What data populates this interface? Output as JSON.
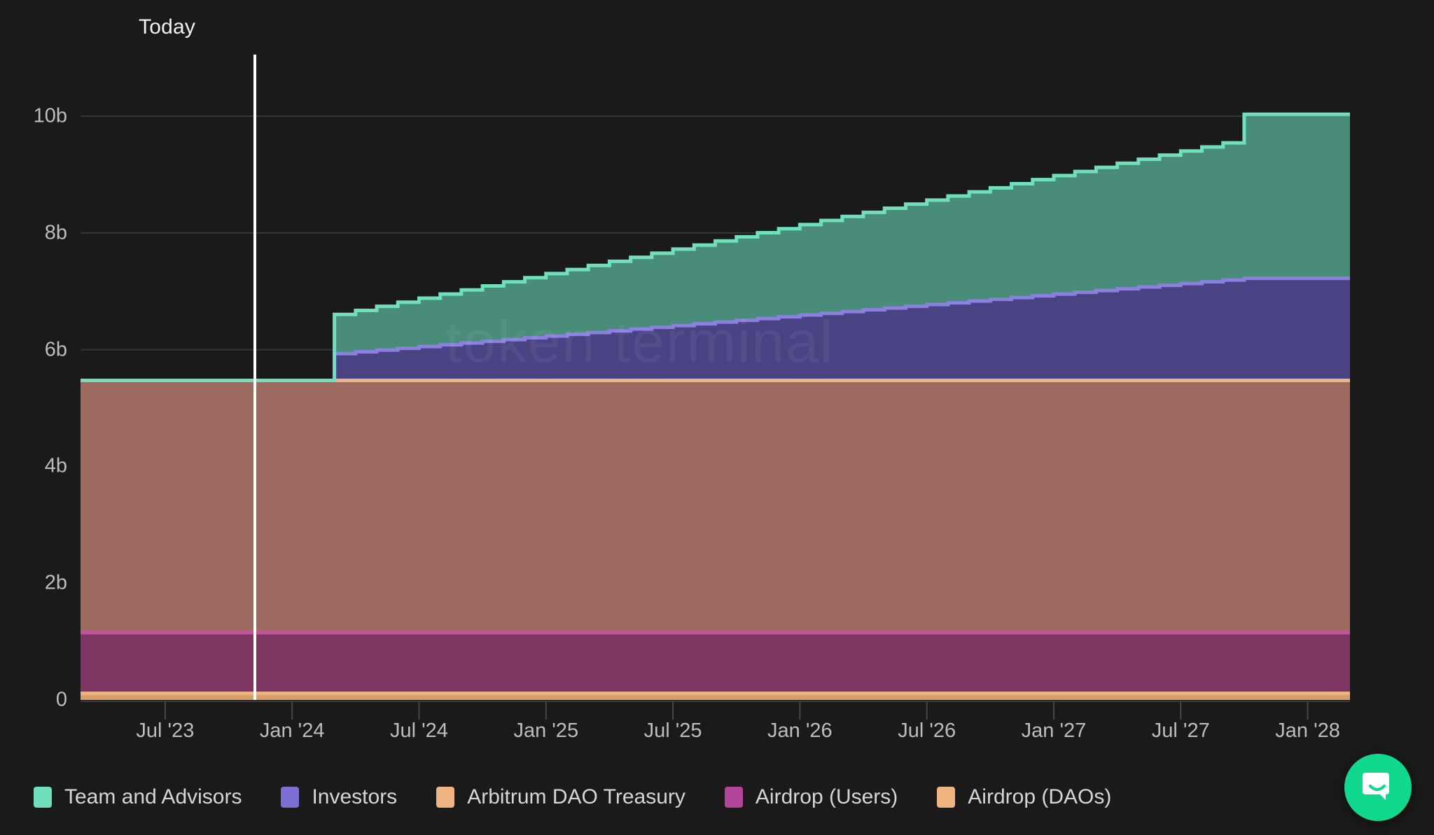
{
  "annotation": {
    "today_label": "Today",
    "today_x_fraction": 0.0958
  },
  "watermark": "token terminal",
  "legend": {
    "items": [
      {
        "label": "Team and Advisors",
        "color": "#6FDFBD"
      },
      {
        "label": "Investors",
        "color": "#7B6FD4"
      },
      {
        "label": "Arbitrum DAO Treasury",
        "color": "#F0B483"
      },
      {
        "label": "Airdrop (Users)",
        "color": "#B3469B"
      },
      {
        "label": "Airdrop (DAOs)",
        "color": "#F0B483"
      }
    ]
  },
  "widgets": {
    "intercom_label": "Open Intercom Messenger",
    "intercom_color": "#10d98e"
  },
  "chart_data": {
    "type": "area",
    "title": "",
    "subtitle": "",
    "xlabel": "",
    "ylabel": "",
    "stacked": true,
    "step": "monthly",
    "grid": true,
    "legend_position": "bottom",
    "ylim": [
      0,
      10400000000
    ],
    "ytick_labels": [
      "0",
      "2b",
      "4b",
      "6b",
      "8b",
      "10b"
    ],
    "ytick_values": [
      0,
      2000000000,
      4000000000,
      6000000000,
      8000000000,
      10000000000
    ],
    "xtick_labels": [
      "Jul '23",
      "Jan '24",
      "Jul '24",
      "Jan '25",
      "Jul '25",
      "Jan '26",
      "Jul '26",
      "Jan '27",
      "Jul '27",
      "Jan '28"
    ],
    "x_start": "2023-03",
    "x_end": "2028-03",
    "series": [
      {
        "name": "Airdrop (DAOs)",
        "color": "#D9A06B",
        "line_color": "#F0B483",
        "values_b": [
          0.113,
          0.113,
          0.113,
          0.113,
          0.113,
          0.113,
          0.113,
          0.113,
          0.113,
          0.113,
          0.113,
          0.113,
          0.113,
          0.113,
          0.113,
          0.113,
          0.113,
          0.113,
          0.113,
          0.113,
          0.113,
          0.113,
          0.113,
          0.113,
          0.113,
          0.113,
          0.113,
          0.113,
          0.113,
          0.113,
          0.113,
          0.113,
          0.113,
          0.113,
          0.113,
          0.113,
          0.113,
          0.113,
          0.113,
          0.113,
          0.113,
          0.113,
          0.113,
          0.113,
          0.113,
          0.113,
          0.113,
          0.113,
          0.113,
          0.113,
          0.113,
          0.113,
          0.113,
          0.113,
          0.113,
          0.113,
          0.113,
          0.113,
          0.113,
          0.113,
          0.113
        ]
      },
      {
        "name": "Airdrop (Users)",
        "color": "#7E3663",
        "line_color": "#C450A5",
        "values_b": [
          1.04,
          1.04,
          1.04,
          1.04,
          1.04,
          1.04,
          1.04,
          1.04,
          1.04,
          1.04,
          1.04,
          1.04,
          1.04,
          1.04,
          1.04,
          1.04,
          1.04,
          1.04,
          1.04,
          1.04,
          1.04,
          1.04,
          1.04,
          1.04,
          1.04,
          1.04,
          1.04,
          1.04,
          1.04,
          1.04,
          1.04,
          1.04,
          1.04,
          1.04,
          1.04,
          1.04,
          1.04,
          1.04,
          1.04,
          1.04,
          1.04,
          1.04,
          1.04,
          1.04,
          1.04,
          1.04,
          1.04,
          1.04,
          1.04,
          1.04,
          1.04,
          1.04,
          1.04,
          1.04,
          1.04,
          1.04,
          1.04,
          1.04,
          1.04,
          1.04,
          1.04
        ]
      },
      {
        "name": "Arbitrum DAO Treasury",
        "color": "#9C6A5E",
        "line_color": "#F0B483",
        "values_b": [
          4.32,
          4.32,
          4.32,
          4.32,
          4.32,
          4.32,
          4.32,
          4.32,
          4.32,
          4.32,
          4.32,
          4.32,
          4.32,
          4.32,
          4.32,
          4.32,
          4.32,
          4.32,
          4.32,
          4.32,
          4.32,
          4.32,
          4.32,
          4.32,
          4.32,
          4.32,
          4.32,
          4.32,
          4.32,
          4.32,
          4.32,
          4.32,
          4.32,
          4.32,
          4.32,
          4.32,
          4.32,
          4.32,
          4.32,
          4.32,
          4.32,
          4.32,
          4.32,
          4.32,
          4.32,
          4.32,
          4.32,
          4.32,
          4.32,
          4.32,
          4.32,
          4.32,
          4.32,
          4.32,
          4.32,
          4.32,
          4.32,
          4.32,
          4.32,
          4.32,
          4.32
        ]
      },
      {
        "name": "Investors",
        "color": "#4A4383",
        "line_color": "#8B7FE0",
        "values_b": [
          0,
          0,
          0,
          0,
          0,
          0,
          0,
          0,
          0,
          0,
          0,
          0,
          0.46,
          0.49,
          0.52,
          0.55,
          0.58,
          0.61,
          0.64,
          0.67,
          0.7,
          0.73,
          0.76,
          0.79,
          0.82,
          0.85,
          0.88,
          0.91,
          0.94,
          0.97,
          1.0,
          1.03,
          1.06,
          1.09,
          1.12,
          1.15,
          1.18,
          1.21,
          1.24,
          1.27,
          1.3,
          1.33,
          1.36,
          1.39,
          1.42,
          1.45,
          1.48,
          1.51,
          1.54,
          1.57,
          1.6,
          1.63,
          1.66,
          1.69,
          1.72,
          1.75,
          1.75,
          1.75,
          1.75,
          1.75,
          1.75
        ]
      },
      {
        "name": "Team and Advisors",
        "color": "#4A8C7A",
        "line_color": "#6FDFBD",
        "values_b": [
          0,
          0,
          0,
          0,
          0,
          0,
          0,
          0,
          0,
          0,
          0,
          0,
          0.67,
          0.71,
          0.75,
          0.79,
          0.83,
          0.87,
          0.91,
          0.95,
          0.99,
          1.03,
          1.07,
          1.11,
          1.15,
          1.19,
          1.23,
          1.27,
          1.31,
          1.35,
          1.39,
          1.43,
          1.47,
          1.51,
          1.55,
          1.59,
          1.63,
          1.67,
          1.71,
          1.75,
          1.79,
          1.83,
          1.87,
          1.91,
          1.95,
          1.99,
          2.03,
          2.07,
          2.11,
          2.15,
          2.19,
          2.23,
          2.27,
          2.31,
          2.35,
          2.81,
          2.81,
          2.81,
          2.81,
          2.81,
          2.81
        ]
      }
    ],
    "totals_b": {
      "start": 5.47,
      "at_vesting_start": 6.6,
      "end": 10.03
    }
  }
}
